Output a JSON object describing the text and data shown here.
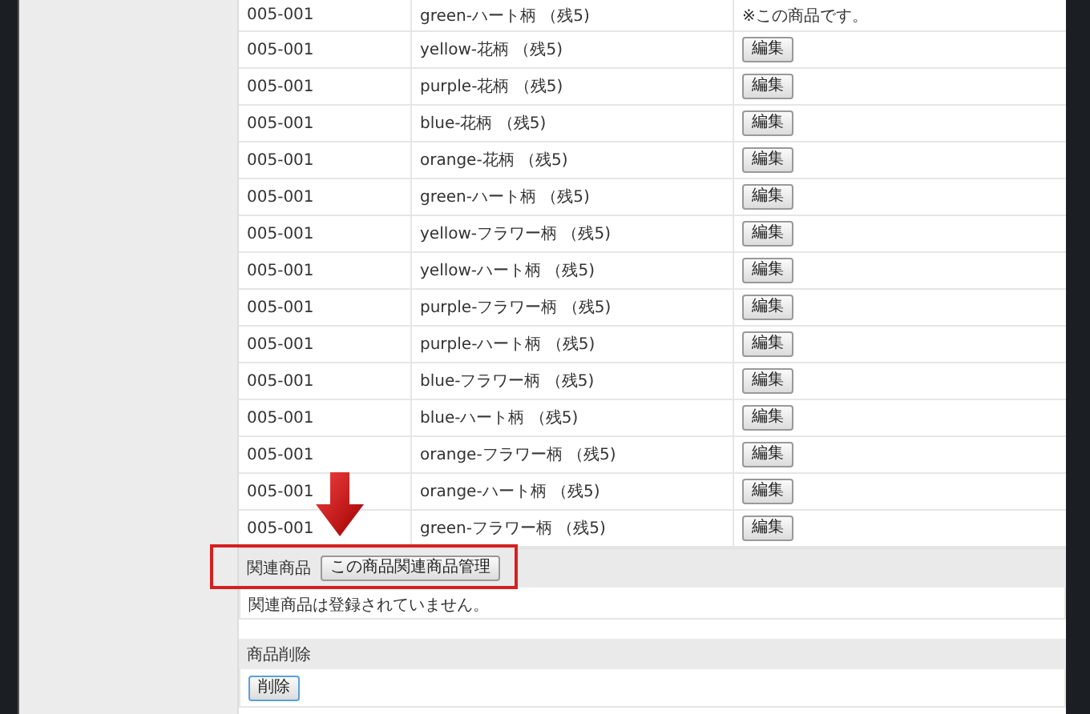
{
  "variants": [
    {
      "code": "005-001",
      "name": "green-ハート柄 （残5)",
      "action": {
        "kind": "note",
        "text": "※この商品です。"
      }
    },
    {
      "code": "005-001",
      "name": "yellow-花柄 （残5)",
      "action": {
        "kind": "button",
        "text": "編集"
      }
    },
    {
      "code": "005-001",
      "name": "purple-花柄 （残5)",
      "action": {
        "kind": "button",
        "text": "編集"
      }
    },
    {
      "code": "005-001",
      "name": "blue-花柄 （残5)",
      "action": {
        "kind": "button",
        "text": "編集"
      }
    },
    {
      "code": "005-001",
      "name": "orange-花柄 （残5)",
      "action": {
        "kind": "button",
        "text": "編集"
      }
    },
    {
      "code": "005-001",
      "name": "green-ハート柄 （残5)",
      "action": {
        "kind": "button",
        "text": "編集"
      }
    },
    {
      "code": "005-001",
      "name": "yellow-フラワー柄 （残5)",
      "action": {
        "kind": "button",
        "text": "編集"
      }
    },
    {
      "code": "005-001",
      "name": "yellow-ハート柄 （残5)",
      "action": {
        "kind": "button",
        "text": "編集"
      }
    },
    {
      "code": "005-001",
      "name": "purple-フラワー柄 （残5)",
      "action": {
        "kind": "button",
        "text": "編集"
      }
    },
    {
      "code": "005-001",
      "name": "purple-ハート柄 （残5)",
      "action": {
        "kind": "button",
        "text": "編集"
      }
    },
    {
      "code": "005-001",
      "name": "blue-フラワー柄 （残5)",
      "action": {
        "kind": "button",
        "text": "編集"
      }
    },
    {
      "code": "005-001",
      "name": "blue-ハート柄 （残5)",
      "action": {
        "kind": "button",
        "text": "編集"
      }
    },
    {
      "code": "005-001",
      "name": "orange-フラワー柄 （残5)",
      "action": {
        "kind": "button",
        "text": "編集"
      }
    },
    {
      "code": "005-001",
      "name": "orange-ハート柄 （残5)",
      "action": {
        "kind": "button",
        "text": "編集"
      }
    },
    {
      "code": "005-001",
      "name": "green-フラワー柄 （残5)",
      "action": {
        "kind": "button",
        "text": "編集"
      }
    }
  ],
  "related": {
    "label": "関連商品",
    "button": "この商品関連商品管理",
    "message": "関連商品は登録されていません。"
  },
  "delete": {
    "label": "商品削除",
    "button": "削除"
  }
}
